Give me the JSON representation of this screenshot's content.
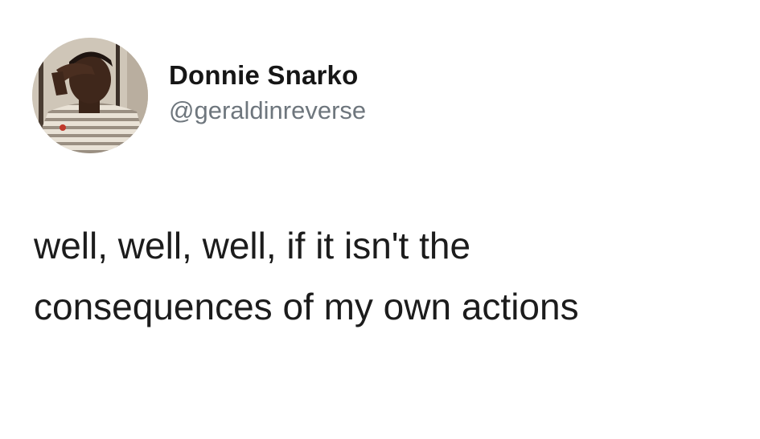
{
  "tweet": {
    "author": {
      "display_name": "Donnie Snarko",
      "handle": "@geraldinreverse",
      "avatar_icon": "profile-photo-avatar"
    },
    "text_lines": [
      "well, well, well, if it isn't the",
      "consequences of my own actions"
    ]
  },
  "colors": {
    "background": "#ffffff",
    "name": "#161616",
    "handle": "#6e767d",
    "text": "#1c1c1c"
  }
}
